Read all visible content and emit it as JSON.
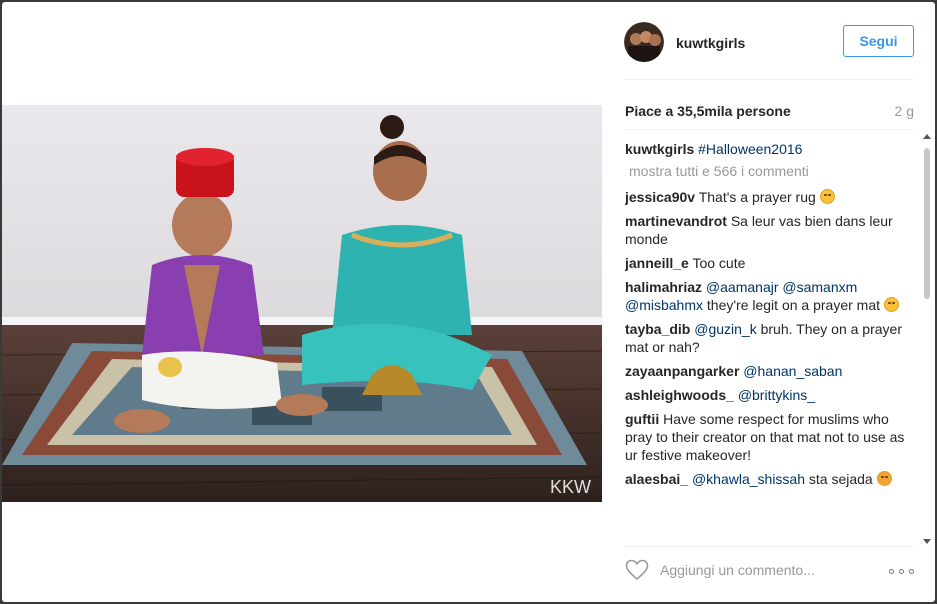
{
  "post": {
    "username": "kuwtkgirls",
    "follow_label": "Segui",
    "likes": "Piace a 35,5mila persone",
    "time_ago": "2 g",
    "watermark": "KKW"
  },
  "caption": {
    "username": "kuwtkgirls",
    "text": "#Halloween2016"
  },
  "load_more": "mostra tutti e 566 i commenti",
  "comments": [
    {
      "user": "jessica90v",
      "text": "That's a prayer rug",
      "emoji": "unamused-emoji",
      "mention": ""
    },
    {
      "user": "martinevandrot",
      "text": "Sa leur vas bien dans leur monde",
      "emoji": "",
      "mention": ""
    },
    {
      "user": "janneill_e",
      "text": "Too cute",
      "emoji": "",
      "mention": ""
    },
    {
      "user": "halimahriaz",
      "mention": "@aamanajr @samanxm @misbahmx",
      "text": "they're legit on a prayer mat",
      "emoji": "unamused-emoji"
    },
    {
      "user": "tayba_dib",
      "mention": "@guzin_k",
      "text": "bruh. They on a prayer mat or nah?",
      "emoji": ""
    },
    {
      "user": "zayaanpangarker",
      "mention": "@hanan_saban",
      "text": "",
      "emoji": ""
    },
    {
      "user": "ashleighwoods_",
      "mention": "@brittykins_",
      "text": "",
      "emoji": ""
    },
    {
      "user": "guftii",
      "text": "Have some respect for muslims who pray to their creator on that mat not to use as ur festive makeover!",
      "emoji": "",
      "mention": ""
    },
    {
      "user": "alaesbai_",
      "mention": "@khawla_shissah",
      "text": "sta sejada",
      "emoji": "angry-emoji"
    }
  ],
  "compose": {
    "placeholder": "Aggiungi un commento..."
  },
  "icons": {
    "heart": "heart-icon",
    "more": "more-options-icon"
  },
  "colors": {
    "accent": "#3897f0",
    "hashtag": "#003569",
    "muted": "#999999"
  }
}
